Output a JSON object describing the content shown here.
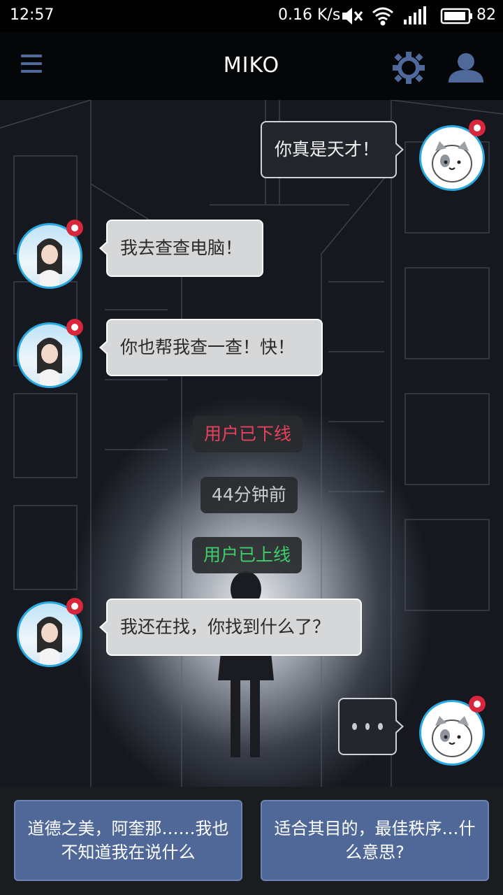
{
  "status_bar": {
    "time": "12:57",
    "net_speed": "0.16 K/s",
    "battery": "82"
  },
  "app_bar": {
    "title": "MIKO",
    "icons": [
      "menu-icon",
      "gear-icon",
      "user-icon"
    ],
    "accent_color": "#4f6a9a"
  },
  "messages": [
    {
      "side": "right",
      "avatar": "cat-avatar",
      "text": "你真是天才！"
    },
    {
      "side": "left",
      "avatar": "girl-avatar",
      "text": "我去查查电脑！"
    },
    {
      "side": "left",
      "avatar": "girl-avatar",
      "text": "你也帮我查一查！快！"
    },
    {
      "side": "left",
      "avatar": "girl-avatar",
      "text": "我还在找，你找到什么了？"
    }
  ],
  "system": {
    "offline": {
      "text": "用户已下线",
      "color": "#e8415e"
    },
    "time_ago": {
      "text": "44分钟前",
      "color": "#c9ccd1"
    },
    "online": {
      "text": "用户已上线",
      "color": "#3ccf6a"
    }
  },
  "choices": [
    {
      "label": "道德之美，阿奎那……我也不知道我在说什么"
    },
    {
      "label": "适合其目的，最佳秩序…什么意思?"
    }
  ]
}
